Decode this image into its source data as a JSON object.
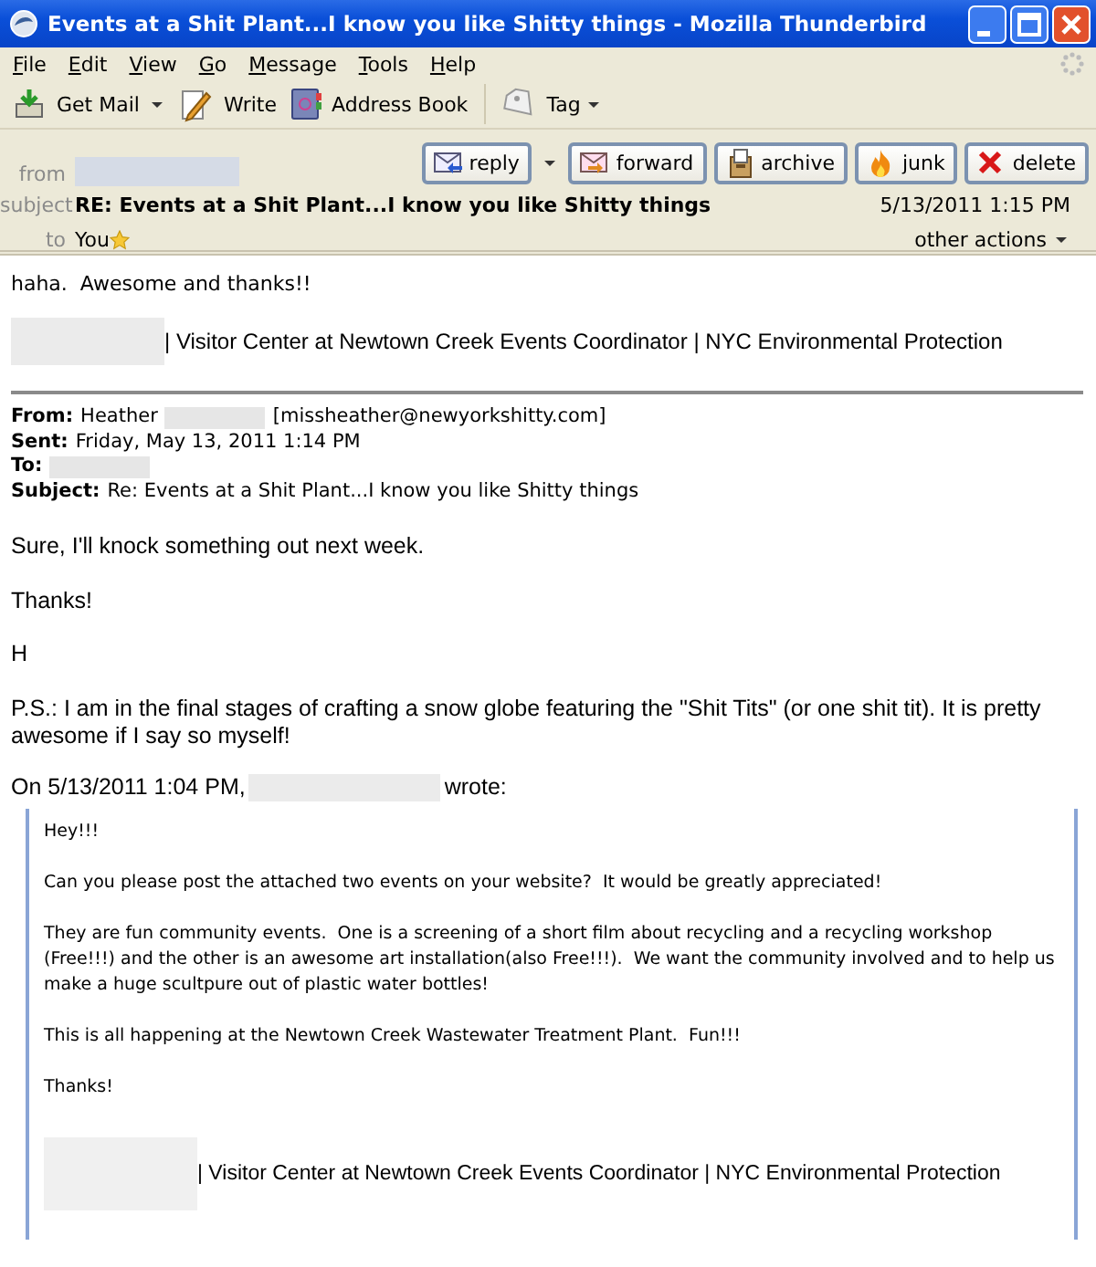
{
  "window": {
    "title": "Events at a Shit Plant...I know you like Shitty things - Mozilla Thunderbird"
  },
  "menu": [
    "File",
    "Edit",
    "View",
    "Go",
    "Message",
    "Tools",
    "Help"
  ],
  "toolbar": [
    {
      "label": "Get Mail",
      "kind": "split"
    },
    {
      "label": "Write",
      "kind": "button"
    },
    {
      "label": "Address Book",
      "kind": "button"
    },
    {
      "label": "Tag",
      "kind": "menu"
    }
  ],
  "header": {
    "from_label": "from",
    "subject_label": "subject",
    "subject": "RE: Events at a Shit Plant...I know you like Shitty things",
    "to_label": "to",
    "to": "You",
    "date": "5/13/2011 1:15 PM",
    "other_actions": "other actions",
    "actions": [
      {
        "label": "reply",
        "kind": "split"
      },
      {
        "label": "forward",
        "kind": "button"
      },
      {
        "label": "archive",
        "kind": "button"
      },
      {
        "label": "junk",
        "kind": "button"
      },
      {
        "label": "delete",
        "kind": "button"
      }
    ]
  },
  "message": {
    "reply": "haha.  Awesome and thanks!!",
    "signature": "| Visitor Center at Newtown Creek Events Coordinator | NYC Environmental Protection",
    "headers": [
      {
        "label": "From:",
        "value": "Heather",
        "redacted": true,
        "after": "[missheather@newyorkshitty.com]"
      },
      {
        "label": "Sent:",
        "value": "Friday, May 13, 2011 1:14 PM",
        "redacted": false
      },
      {
        "label": "To:",
        "redacted": true
      },
      {
        "label": "Subject:",
        "value": "Re: Events at a Shit Plant...I know you like Shitty things",
        "redacted": false
      }
    ],
    "paragraphs": [
      "Sure, I'll knock something out next week.",
      "Thanks!",
      "H",
      "P.S.: I am in the final stages of crafting a snow globe featuring the \"Shit Tits\" (or one shit tit). It is pretty awesome if I say so myself!"
    ],
    "attribution": {
      "before": "On 5/13/2011 1:04 PM,",
      "after": "wrote:"
    },
    "quote": {
      "paragraphs": [
        "Hey!!!",
        "Can you please post the attached two events on your website?  It would be greatly appreciated!",
        "They are fun community events.  One is a screening of a short film about recycling and a recycling workshop (Free!!!) and the other is an awesome art installation(also Free!!!).  We want the community involved and to help us make a huge scultpure out of plastic water bottles!",
        "This is all happening at the Newtown Creek Wastewater Treatment Plant.  Fun!!!",
        "Thanks!"
      ],
      "signature": "| Visitor Center at Newtown Creek Events Coordinator | NYC Environmental Protection"
    }
  }
}
